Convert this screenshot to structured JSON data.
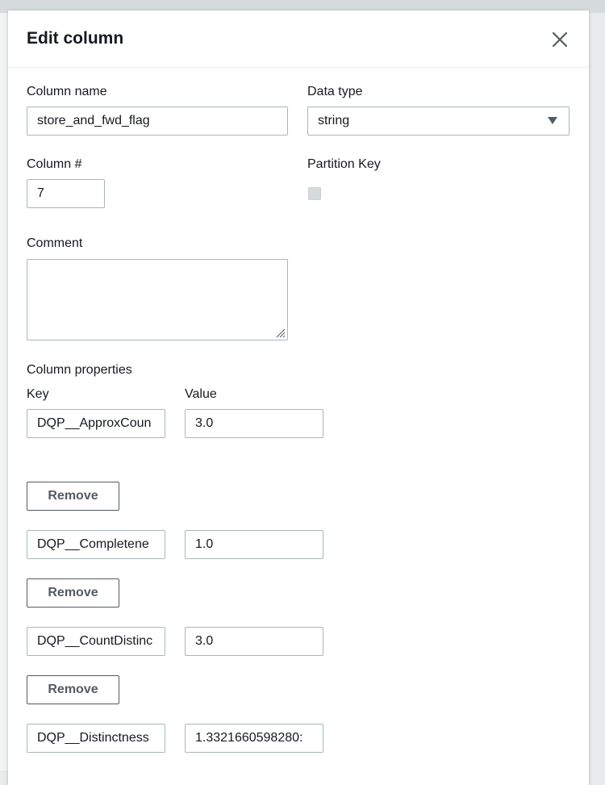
{
  "dialog": {
    "title": "Edit column",
    "close_icon": "close-icon"
  },
  "fields": {
    "column_name": {
      "label": "Column name",
      "value": "store_and_fwd_flag"
    },
    "data_type": {
      "label": "Data type",
      "value": "string"
    },
    "column_number": {
      "label": "Column #",
      "value": "7"
    },
    "partition_key": {
      "label": "Partition Key",
      "checked": false
    },
    "comment": {
      "label": "Comment",
      "value": ""
    }
  },
  "properties": {
    "label": "Column properties",
    "key_label": "Key",
    "value_label": "Value",
    "remove_label": "Remove",
    "rows": [
      {
        "key": "DQP__ApproxCoun",
        "value": "3.0"
      },
      {
        "key": "DQP__Completene",
        "value": "1.0"
      },
      {
        "key": "DQP__CountDistinc",
        "value": "3.0"
      },
      {
        "key": "DQP__Distinctness",
        "value": "1.3321660598280:"
      }
    ]
  }
}
